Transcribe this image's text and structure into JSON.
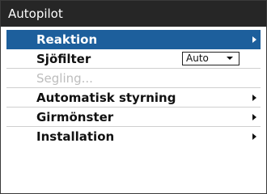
{
  "dialog": {
    "title": "Autopilot"
  },
  "menu": {
    "items": [
      {
        "label": "Reaktion",
        "state": "selected",
        "icon": "chevron-right-icon"
      },
      {
        "label": "Sjöfilter",
        "control": {
          "type": "dropdown",
          "value": "Auto"
        }
      },
      {
        "label": "Segling...",
        "state": "disabled"
      },
      {
        "label": "Automatisk styrning",
        "icon": "chevron-right-icon"
      },
      {
        "label": "Girmönster",
        "icon": "chevron-right-icon"
      },
      {
        "label": "Installation",
        "icon": "chevron-right-icon"
      }
    ]
  },
  "colors": {
    "titlebar": "#262626",
    "selection": "#1d5f9c",
    "disabled_text": "#bdbdbd"
  }
}
